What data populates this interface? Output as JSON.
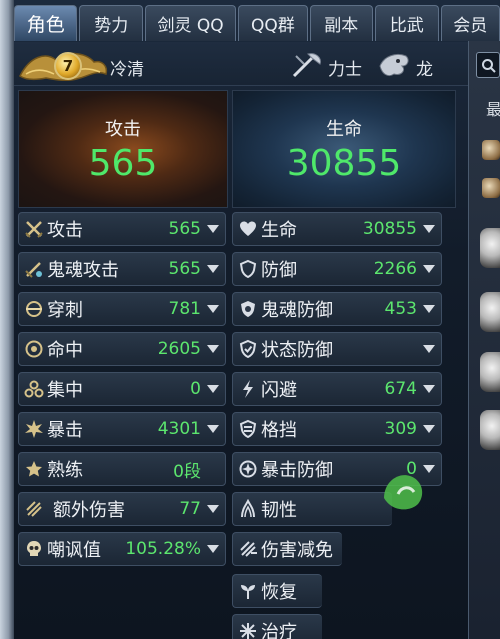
{
  "tabs": [
    {
      "label": "角色",
      "active": true
    },
    {
      "label": "势力"
    },
    {
      "label": "剑灵 QQ"
    },
    {
      "label": "QQ群"
    },
    {
      "label": "副本"
    },
    {
      "label": "比武"
    },
    {
      "label": "会员"
    }
  ],
  "header": {
    "level": "7",
    "name": "冷清",
    "class_label": "力士",
    "race_label": "龙"
  },
  "summary": {
    "attack_label": "攻击",
    "attack_value": "565",
    "life_label": "生命",
    "life_value": "30855"
  },
  "left_stats": [
    {
      "label": "攻击",
      "value": "565",
      "icon": "crossed-swords-icon"
    },
    {
      "label": "鬼魂攻击",
      "value": "565",
      "icon": "spirit-sword-icon"
    },
    {
      "label": "穿刺",
      "value": "781",
      "icon": "pierce-icon"
    },
    {
      "label": "命中",
      "value": "2605",
      "icon": "target-icon"
    },
    {
      "label": "集中",
      "value": "0",
      "icon": "focus-icon"
    },
    {
      "label": "暴击",
      "value": "4301",
      "icon": "critical-burst-icon"
    },
    {
      "label": "熟练",
      "value": "0段",
      "icon": "star-icon"
    },
    {
      "label": "额外伤害",
      "value": "77",
      "icon": "extra-damage-icon"
    },
    {
      "label": "嘲讽值",
      "value": "105.28%",
      "icon": "skull-icon"
    }
  ],
  "right_stats": [
    {
      "label": "生命",
      "value": "30855",
      "icon": "heart-icon"
    },
    {
      "label": "防御",
      "value": "2266",
      "icon": "shield-icon"
    },
    {
      "label": "鬼魂防御",
      "value": "453",
      "icon": "spirit-shield-icon"
    },
    {
      "label": "状态防御",
      "value": "",
      "icon": "status-shield-icon"
    },
    {
      "label": "闪避",
      "value": "674",
      "icon": "evade-icon"
    },
    {
      "label": "格挡",
      "value": "309",
      "icon": "block-icon"
    },
    {
      "label": "暴击防御",
      "value": "0",
      "icon": "crit-defense-icon"
    },
    {
      "label": "韧性",
      "value": "",
      "icon": "toughness-icon"
    },
    {
      "label": "伤害减免",
      "value": "",
      "icon": "damage-reduction-icon"
    },
    {
      "label": "恢复",
      "value": "",
      "icon": "sprout-icon"
    },
    {
      "label": "治疗",
      "value": "",
      "icon": "heal-icon"
    }
  ],
  "side": {
    "partial_text": "最"
  }
}
